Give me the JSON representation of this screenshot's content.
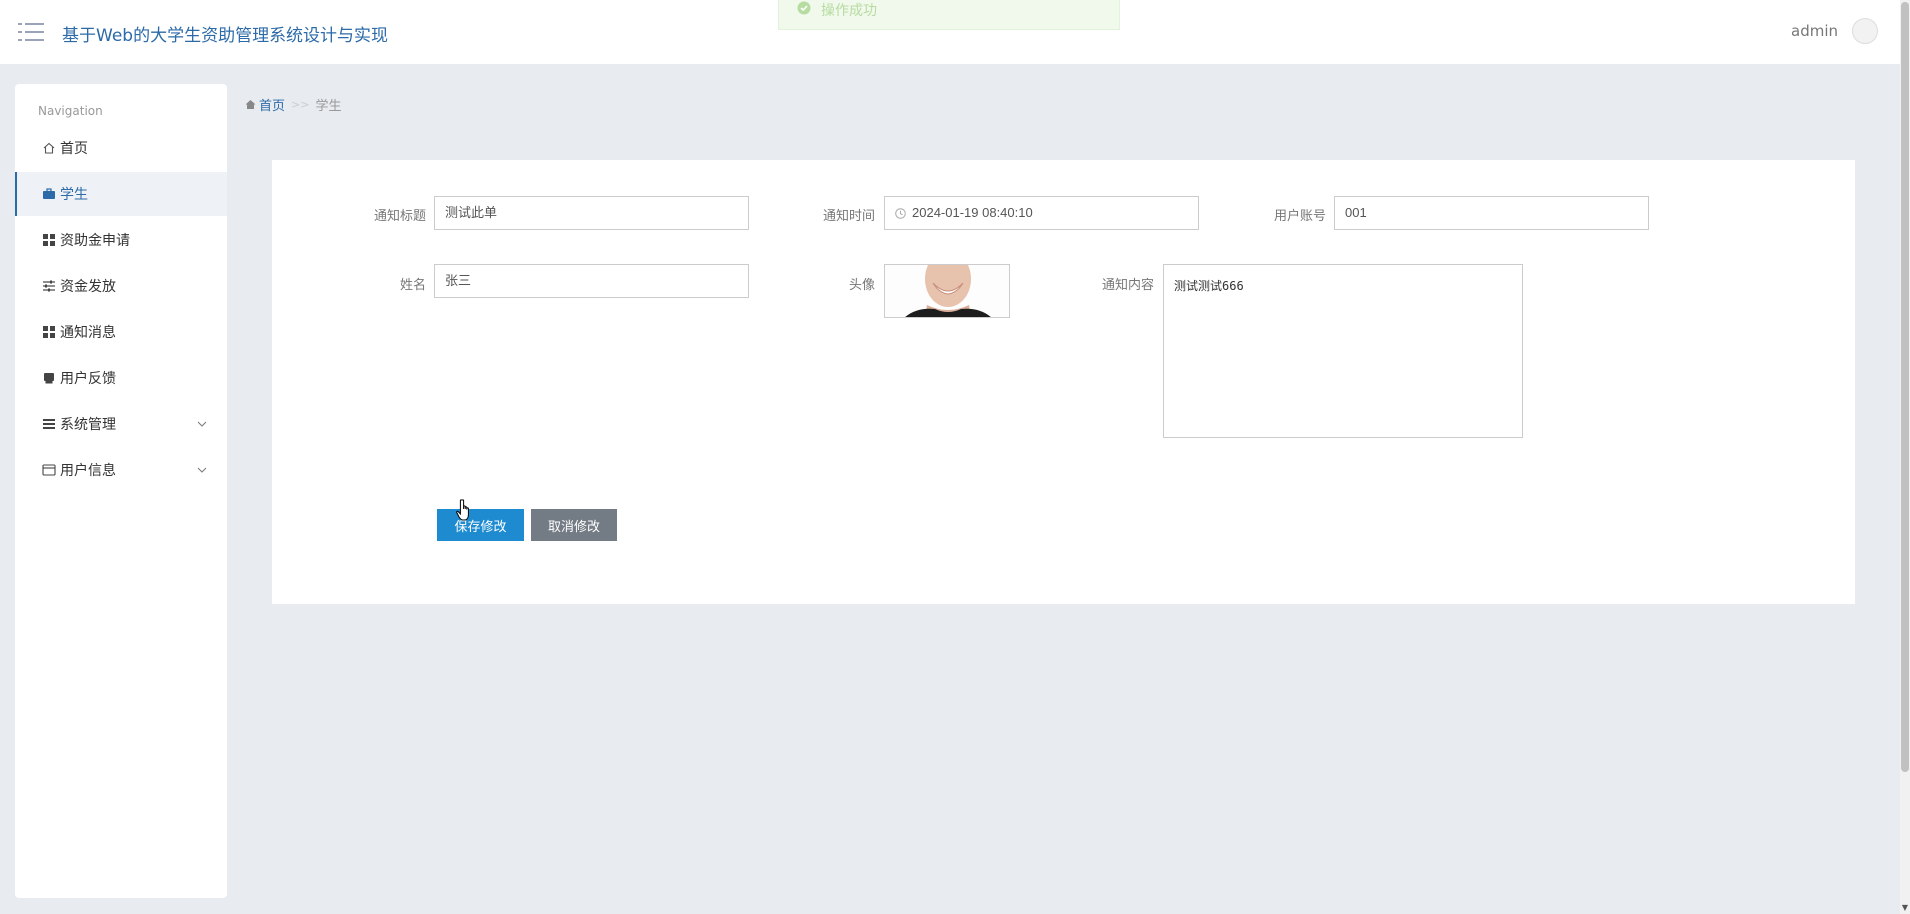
{
  "header": {
    "app_title": "基于Web的大学生资助管理系统设计与实现",
    "user_name": "admin"
  },
  "toast": {
    "text": "操作成功"
  },
  "sidebar": {
    "heading": "Navigation",
    "items": [
      {
        "label": "首页",
        "icon": "home-icon"
      },
      {
        "label": "学生",
        "icon": "briefcase-icon",
        "active": true
      },
      {
        "label": "资助金申请",
        "icon": "grid-icon"
      },
      {
        "label": "资金发放",
        "icon": "sliders-icon"
      },
      {
        "label": "通知消息",
        "icon": "grid-icon"
      },
      {
        "label": "用户反馈",
        "icon": "printer-icon"
      },
      {
        "label": "系统管理",
        "icon": "list-icon",
        "expandable": true
      },
      {
        "label": "用户信息",
        "icon": "card-icon",
        "expandable": true
      }
    ]
  },
  "breadcrumb": {
    "home": "首页",
    "separator": ">>",
    "current": "学生"
  },
  "form": {
    "title_label": "通知标题",
    "title_value": "测试此单",
    "time_label": "通知时间",
    "time_value": "2024-01-19 08:40:10",
    "account_label": "用户账号",
    "account_value": "001",
    "name_label": "姓名",
    "name_value": "张三",
    "avatar_label": "头像",
    "content_label": "通知内容",
    "content_value": "测试测试666",
    "save_label": "保存修改",
    "cancel_label": "取消修改"
  },
  "colors": {
    "accent": "#2c6aa8",
    "save_button": "#1e8bd1",
    "cancel_button": "#737b85",
    "background": "#e8ebf0"
  }
}
